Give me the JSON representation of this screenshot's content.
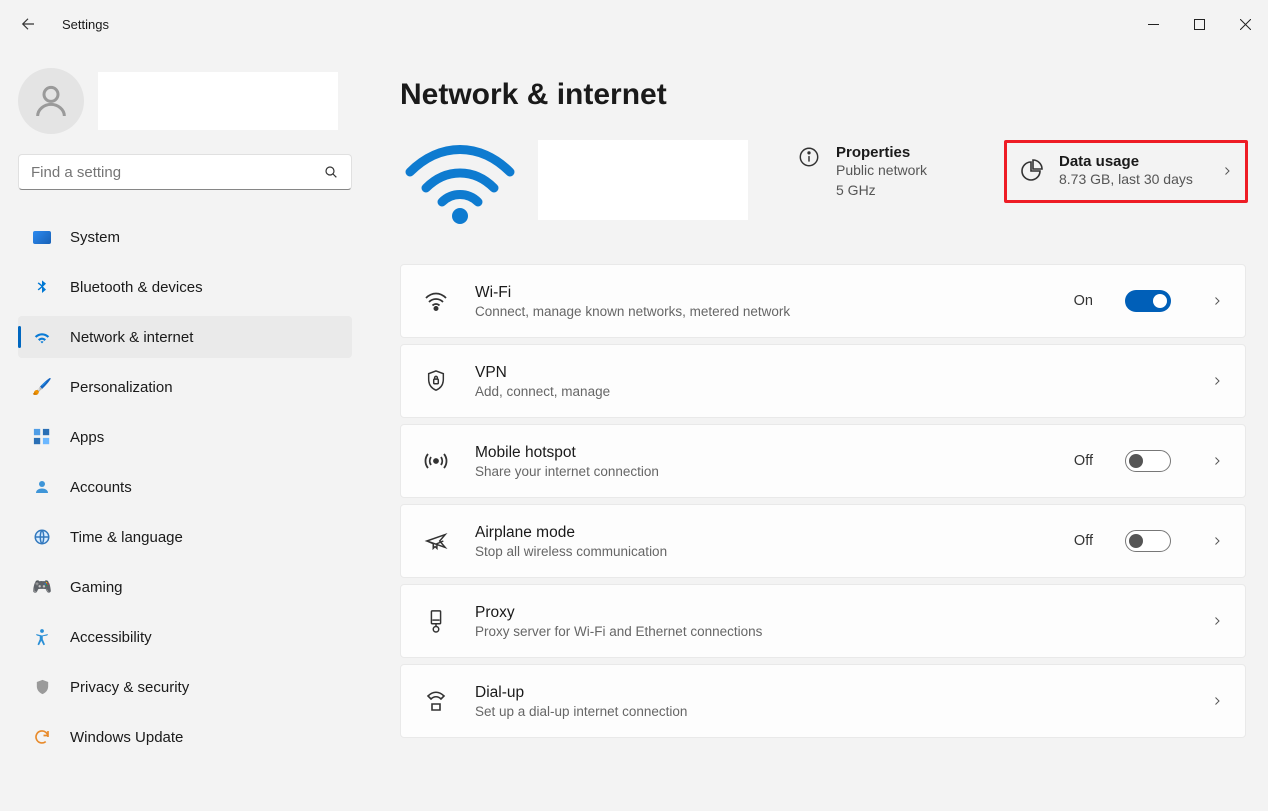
{
  "window": {
    "title": "Settings"
  },
  "search": {
    "placeholder": "Find a setting"
  },
  "sidebar": {
    "items": [
      {
        "label": "System"
      },
      {
        "label": "Bluetooth & devices"
      },
      {
        "label": "Network & internet"
      },
      {
        "label": "Personalization"
      },
      {
        "label": "Apps"
      },
      {
        "label": "Accounts"
      },
      {
        "label": "Time & language"
      },
      {
        "label": "Gaming"
      },
      {
        "label": "Accessibility"
      },
      {
        "label": "Privacy & security"
      },
      {
        "label": "Windows Update"
      }
    ]
  },
  "page": {
    "title": "Network & internet",
    "properties": {
      "title": "Properties",
      "line1": "Public network",
      "line2": "5 GHz"
    },
    "data_usage": {
      "title": "Data usage",
      "sub": "8.73 GB, last 30 days"
    },
    "rows": {
      "wifi": {
        "title": "Wi-Fi",
        "sub": "Connect, manage known networks, metered network",
        "state": "On"
      },
      "vpn": {
        "title": "VPN",
        "sub": "Add, connect, manage"
      },
      "hotspot": {
        "title": "Mobile hotspot",
        "sub": "Share your internet connection",
        "state": "Off"
      },
      "airplane": {
        "title": "Airplane mode",
        "sub": "Stop all wireless communication",
        "state": "Off"
      },
      "proxy": {
        "title": "Proxy",
        "sub": "Proxy server for Wi-Fi and Ethernet connections"
      },
      "dialup": {
        "title": "Dial-up",
        "sub": "Set up a dial-up internet connection"
      }
    }
  }
}
